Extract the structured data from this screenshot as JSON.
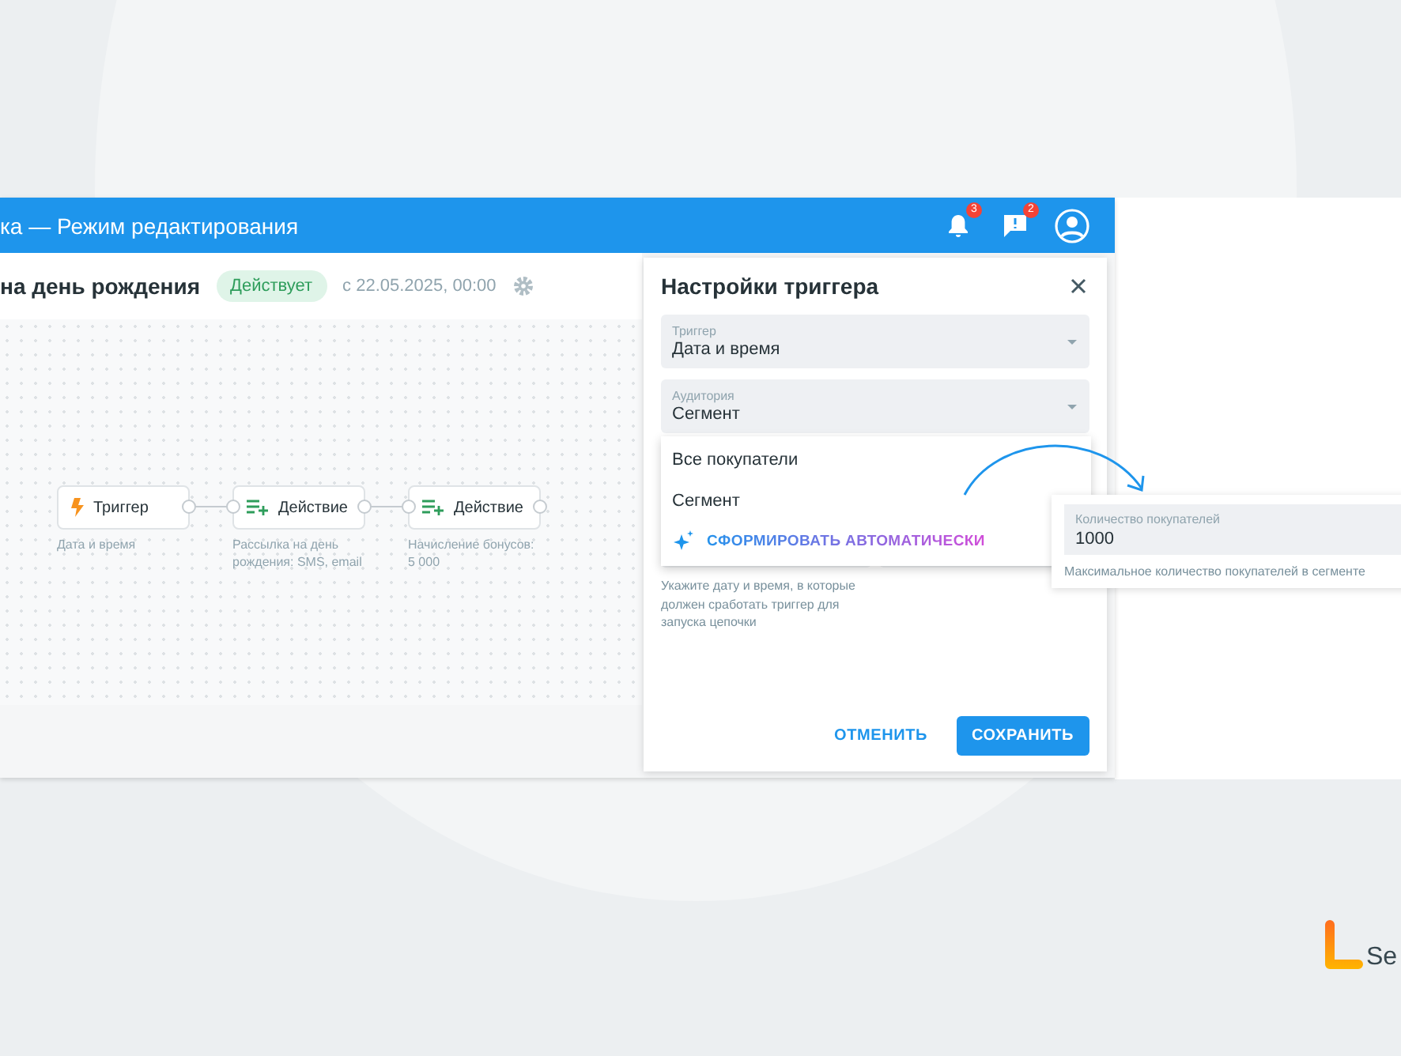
{
  "window": {
    "title": "ка — Режим редактирования",
    "notification_count": "3",
    "message_count": "2"
  },
  "chain": {
    "title": "на день рождения",
    "status": "Действует",
    "since": "с 22.05.2025, 00:00"
  },
  "nodes": [
    {
      "kind": "trigger",
      "label": "Триггер",
      "description": "Дата и время"
    },
    {
      "kind": "action",
      "label": "Действие",
      "description": "Рассылка на день рождения: SMS, email"
    },
    {
      "kind": "action",
      "label": "Действие",
      "description": "Начисление бонусов: 5 000"
    }
  ],
  "dialog": {
    "title": "Настройки триггера",
    "fields": [
      {
        "label": "Триггер",
        "value": "Дата и время"
      },
      {
        "label": "Аудитория",
        "value": "Сегмент"
      }
    ],
    "menu": {
      "options": [
        "Все покупатели",
        "Сегмент"
      ],
      "auto_button": "СФОРМИРОВАТЬ АВТОМАТИЧЕСКИ"
    },
    "hint": "Укажите дату и время, в которые должен сработать триггер для запуска цепочки",
    "buttons": [
      {
        "kind": "text",
        "label": "ОТМЕНИТЬ"
      },
      {
        "kind": "filled",
        "label": "СОХРАНИТЬ"
      }
    ]
  },
  "segment_card": {
    "label": "Количество покупателей",
    "value": "1000",
    "hint": "Максимальное количество покупателей в сегменте"
  },
  "logo": {
    "text": "Se"
  }
}
